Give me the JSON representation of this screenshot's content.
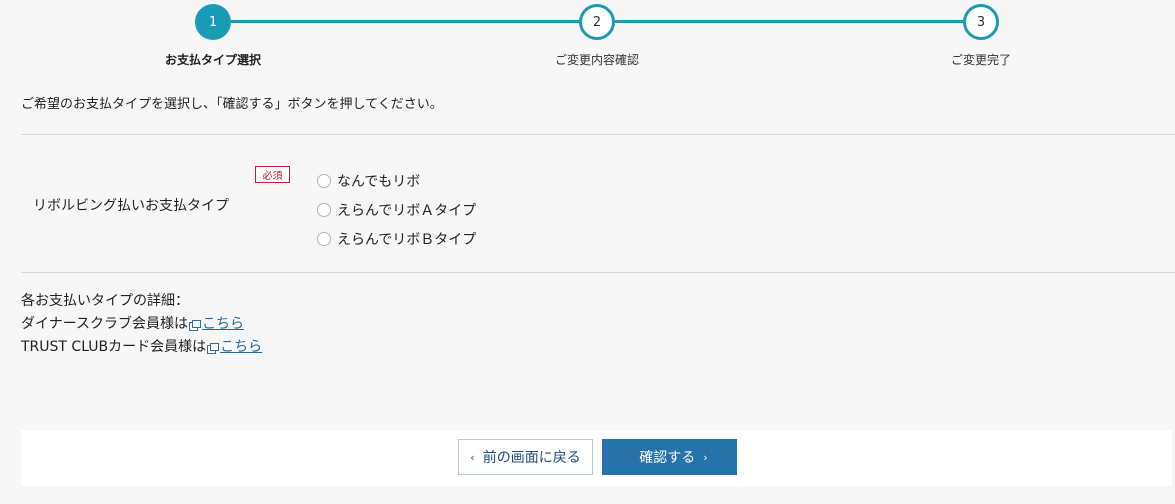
{
  "stepper": {
    "steps": [
      {
        "number": "1",
        "label": "お支払タイプ選択",
        "active": true
      },
      {
        "number": "2",
        "label": "ご変更内容確認",
        "active": false
      },
      {
        "number": "3",
        "label": "ご変更完了",
        "active": false
      }
    ],
    "accent_color": "#1a9bb5"
  },
  "instruction": "ご希望のお支払タイプを選択し、「確認する」ボタンを押してください。",
  "form": {
    "field_label": "リボルビング払いお支払タイプ",
    "required_label": "必須",
    "options": [
      {
        "label": "なんでもリボ"
      },
      {
        "label": "えらんでリボＡタイプ"
      },
      {
        "label": "えらんでリボＢタイプ"
      }
    ]
  },
  "details": {
    "heading": "各お支払いタイプの詳細：",
    "rows": [
      {
        "text": "ダイナースクラブ会員様は",
        "link": "こちら"
      },
      {
        "text": "TRUST CLUBカード会員様は",
        "link": "こちら"
      }
    ]
  },
  "footer": {
    "back_label": "前の画面に戻る",
    "back_chevron": "‹",
    "confirm_label": "確認する",
    "confirm_chevron": "›"
  }
}
